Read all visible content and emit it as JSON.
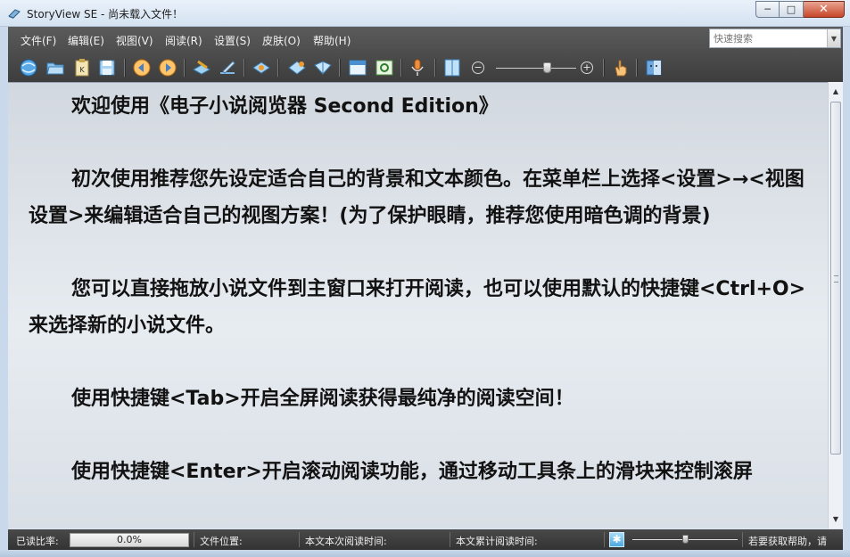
{
  "window": {
    "title": "StoryView SE - 尚未载入文件！",
    "controls": {
      "minimize": "─",
      "maximize": "□",
      "close": "✕"
    }
  },
  "menu": {
    "items": [
      "文件(F)",
      "编辑(E)",
      "视图(V)",
      "阅读(R)",
      "设置(S)",
      "皮肤(O)",
      "帮助(H)"
    ]
  },
  "search": {
    "placeholder": "快速搜索",
    "value": ""
  },
  "toolbar": {
    "icons": [
      "home-globe-icon",
      "open-folder-icon",
      "bookmark-clipboard-icon",
      "save-disk-icon",
      "previous-arrow-icon",
      "next-arrow-icon",
      "edit-book-icon",
      "pen-icon",
      "eye-view-icon",
      "diamond-icon",
      "book-icon",
      "window-layout-icon",
      "picture-frame-icon",
      "microphone-icon",
      "column-layout-icon",
      "zoom-out-icon",
      "zoom-in-icon",
      "hand-icon",
      "finder-face-icon"
    ],
    "zoom_level": 0.65
  },
  "content": {
    "paragraphs": [
      "欢迎使用《电子小说阅览器 Second Edition》",
      "初次使用推荐您先设定适合自己的背景和文本颜色。在菜单栏上选择<设置>→<视图设置>来编辑适合自己的视图方案！(为了保护眼睛，推荐您使用暗色调的背景)",
      "您可以直接拖放小说文件到主窗口来打开阅读，也可以使用默认的快捷键<Ctrl+O>来选择新的小说文件。",
      "使用快捷键<Tab>开启全屏阅读获得最纯净的阅读空间！",
      "使用快捷键<Enter>开启滚动阅读功能，通过移动工具条上的滑块来控制滚屏"
    ]
  },
  "statusbar": {
    "read_ratio_label": "已读比率:",
    "read_ratio_value": "0.0%",
    "file_position_label": "文件位置:",
    "session_time_label": "本文本次阅读时间:",
    "total_time_label": "本文累计阅读时间:",
    "help_text": "若要获取帮助，请",
    "scroll_speed": 0.5
  },
  "colors": {
    "chrome": "#4a4a4a",
    "content_bg": "#e2e7ec",
    "text": "#121212"
  }
}
